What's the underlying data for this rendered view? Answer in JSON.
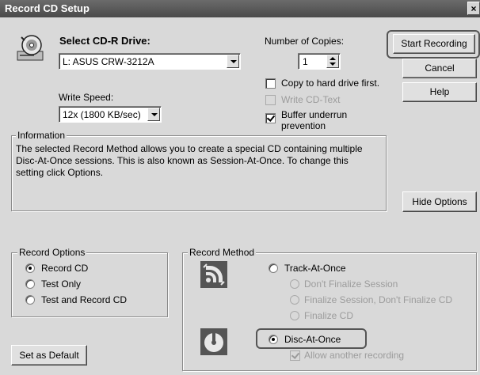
{
  "window": {
    "title": "Record CD Setup",
    "close_glyph": "×"
  },
  "drive": {
    "label": "Select CD-R Drive:",
    "selected": "L: ASUS CRW-3212A"
  },
  "copies": {
    "label": "Number of Copies:",
    "value": "1"
  },
  "write_speed": {
    "label": "Write Speed:",
    "selected": "12x (1800 KB/sec)"
  },
  "options": {
    "copy_to_hard_drive": {
      "label": "Copy to hard drive first.",
      "checked": false
    },
    "write_cd_text": {
      "label": "Write CD-Text",
      "checked": false,
      "disabled": true
    },
    "buffer_underrun": {
      "label_line1": "Buffer underrun",
      "label_line2": "prevention",
      "checked": true
    }
  },
  "buttons": {
    "start_recording": "Start Recording",
    "cancel": "Cancel",
    "help": "Help",
    "hide_options": "Hide Options",
    "set_as_default": "Set as Default"
  },
  "information": {
    "label": "Information",
    "line1": "The selected Record Method allows you to create a special CD containing multiple",
    "line2": "Disc-At-Once sessions. This is also known as Session-At-Once. To change this",
    "line3": "setting click Options."
  },
  "record_options": {
    "label": "Record Options",
    "items": [
      {
        "label": "Record CD",
        "selected": true
      },
      {
        "label": "Test Only",
        "selected": false
      },
      {
        "label": "Test and Record CD",
        "selected": false
      }
    ]
  },
  "record_method": {
    "label": "Record Method",
    "track_at_once": {
      "label": "Track-At-Once",
      "selected": false
    },
    "track_sub": [
      {
        "label": "Don't Finalize Session"
      },
      {
        "label": "Finalize Session, Don't Finalize CD"
      },
      {
        "label": "Finalize CD"
      }
    ],
    "disc_at_once": {
      "label": "Disc-At-Once",
      "selected": true
    },
    "allow_another": {
      "label": "Allow another recording",
      "checked": true,
      "disabled": true
    }
  },
  "icons": {
    "drive": "cd-drive-icon",
    "track": "track-at-once-icon",
    "disc": "disc-at-once-icon"
  },
  "colors": {
    "titlebar": "#4a4a4a",
    "dialog": "#d9d9d9",
    "disabled_text": "#9c9c9c"
  }
}
